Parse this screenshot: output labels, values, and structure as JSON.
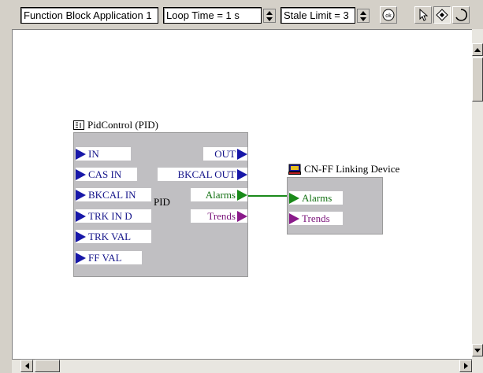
{
  "toolbar": {
    "application_select": "Function Block Application 1",
    "loop_time": "Loop Time = 1 s",
    "stale_limit": "Stale Limit = 3",
    "ok_label": "ok"
  },
  "pid_block": {
    "title": "PidControl (PID)",
    "center_label": "PID",
    "inputs": [
      {
        "label": "IN"
      },
      {
        "label": "CAS IN"
      },
      {
        "label": "BKCAL IN"
      },
      {
        "label": "TRK IN D"
      },
      {
        "label": "TRK VAL"
      },
      {
        "label": "FF VAL"
      }
    ],
    "outputs": [
      {
        "label": "OUT"
      },
      {
        "label": "BKCAL OUT"
      },
      {
        "label": "Alarms"
      },
      {
        "label": "Trends"
      }
    ]
  },
  "linking_device": {
    "title": "CN-FF Linking Device",
    "inputs": [
      {
        "label": "Alarms"
      },
      {
        "label": "Trends"
      }
    ]
  },
  "colors": {
    "port_blue": "#1818a8",
    "port_green": "#1a8a1a",
    "port_purple": "#8a1a8a",
    "block_fill": "#c0bfc2",
    "link_line": "#1a8a1a"
  }
}
